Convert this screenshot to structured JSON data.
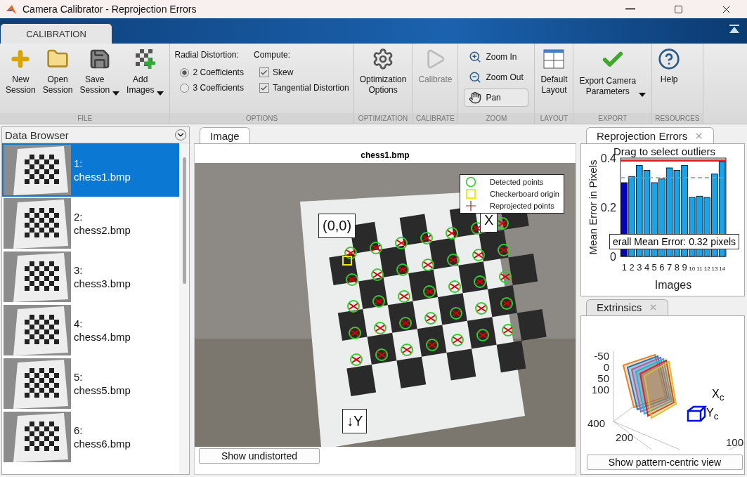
{
  "window": {
    "title": "Camera Calibrator - Reprojection Errors"
  },
  "ribbon_tabs": [
    {
      "label": "CALIBRATION",
      "selected": true
    }
  ],
  "toolbar": [
    {
      "kind": "buttons",
      "label": "FILE",
      "buttons": [
        {
          "label": "New\nSession",
          "dropdown": false,
          "disabled": false
        },
        {
          "label": "Open\nSession",
          "dropdown": false,
          "disabled": false
        },
        {
          "label": "Save\nSession",
          "dropdown": true,
          "disabled": false
        },
        {
          "label": "Add\nImages",
          "dropdown": true,
          "disabled": false
        }
      ]
    },
    {
      "kind": "options",
      "label": "OPTIONS",
      "radial": {
        "label": "Radial Distortion:",
        "options": [
          {
            "label": "2 Coefficients",
            "selected": true
          },
          {
            "label": "3 Coefficients",
            "selected": false
          }
        ]
      },
      "compute": {
        "label": "Compute:",
        "options": [
          {
            "label": "Skew",
            "checked": true
          },
          {
            "label": "Tangential Distortion",
            "checked": true
          }
        ]
      }
    },
    {
      "kind": "buttons",
      "label": "OPTIMIZATION",
      "buttons": [
        {
          "label": "Optimization\nOptions",
          "dropdown": false,
          "disabled": false
        }
      ]
    },
    {
      "kind": "buttons",
      "label": "CALIBRATE",
      "buttons": [
        {
          "label": "Calibrate",
          "dropdown": false,
          "disabled": true
        }
      ]
    },
    {
      "kind": "zoom",
      "label": "ZOOM",
      "tools": [
        {
          "label": "Zoom In",
          "selected": false
        },
        {
          "label": "Zoom Out",
          "selected": false
        },
        {
          "label": "Pan",
          "selected": true
        }
      ]
    },
    {
      "kind": "buttons",
      "label": "LAYOUT",
      "buttons": [
        {
          "label": "Default\nLayout",
          "dropdown": false,
          "disabled": false
        }
      ]
    },
    {
      "kind": "buttons",
      "label": "EXPORT",
      "buttons": [
        {
          "label": "Export Camera\nParameters",
          "dropdown": true,
          "disabled": false
        }
      ]
    },
    {
      "kind": "buttons",
      "label": "RESOURCES",
      "buttons": [
        {
          "label": "Help",
          "dropdown": false,
          "disabled": false
        }
      ]
    }
  ],
  "data_browser": {
    "title": "Data Browser",
    "items": [
      {
        "index": "1:",
        "file": "chess1.bmp",
        "selected": true
      },
      {
        "index": "2:",
        "file": "chess2.bmp",
        "selected": false
      },
      {
        "index": "3:",
        "file": "chess3.bmp",
        "selected": false
      },
      {
        "index": "4:",
        "file": "chess4.bmp",
        "selected": false
      },
      {
        "index": "5:",
        "file": "chess5.bmp",
        "selected": false
      },
      {
        "index": "6:",
        "file": "chess6.bmp",
        "selected": false
      }
    ]
  },
  "image_panel": {
    "tab": {
      "label": "Image",
      "selected": true
    },
    "title": "chess1.bmp",
    "legend": [
      {
        "kind": "circle",
        "label": "Detected points"
      },
      {
        "kind": "square",
        "label": "Checkerboard origin"
      },
      {
        "kind": "plus",
        "label": "Reprojected points"
      }
    ],
    "annotations": [
      {
        "kind": "origin",
        "text": "(0,0)"
      },
      {
        "kind": "x",
        "text": "X"
      },
      {
        "kind": "y",
        "text": "↓Y"
      }
    ],
    "button": "Show undistorted"
  },
  "reprojection_panel": {
    "tab": {
      "label": "Reprojection Errors",
      "selected": true
    },
    "hint": "Drag to select outliers",
    "mean_label": "erall Mean Error: 0.32 pixels",
    "bars": [
      {
        "selected": true
      },
      {
        "selected": false
      },
      {
        "selected": false
      },
      {
        "selected": false
      },
      {
        "selected": false
      },
      {
        "selected": false
      },
      {
        "selected": false
      },
      {
        "selected": false
      },
      {
        "selected": false
      },
      {
        "selected": false
      },
      {
        "selected": false
      },
      {
        "selected": false
      },
      {
        "selected": false
      },
      {
        "selected": false
      }
    ],
    "chart_data": {
      "type": "bar",
      "xlabel": "Images",
      "ylabel": "Mean Error in Pixels",
      "categories": [
        "1",
        "2",
        "3",
        "4",
        "5",
        "6",
        "7",
        "8",
        "9",
        "10",
        "11",
        "12",
        "13",
        "14"
      ],
      "values": [
        0.3,
        0.325,
        0.37,
        0.35,
        0.3,
        0.315,
        0.36,
        0.35,
        0.37,
        0.24,
        0.245,
        0.24,
        0.335,
        0.385
      ],
      "ylim": [
        0,
        0.4
      ],
      "yticks": [
        0,
        0.2,
        0.4
      ],
      "ref_lines": [
        {
          "axis": "y",
          "value": 0.32,
          "color": "#66aabb"
        },
        {
          "axis": "y",
          "value": 0.39,
          "color": "#dd2222"
        }
      ]
    }
  },
  "extrinsics_panel": {
    "tab": {
      "label": "Extrinsics",
      "selected": false
    },
    "z_ticks": [
      "-50",
      "0",
      "50",
      "100"
    ],
    "y_ticks": [
      "400",
      "200"
    ],
    "x_tick": "100",
    "camera_axes": [
      "X$_{c}$",
      "Y$_{c}$"
    ],
    "button": "Show pattern-centric view"
  }
}
